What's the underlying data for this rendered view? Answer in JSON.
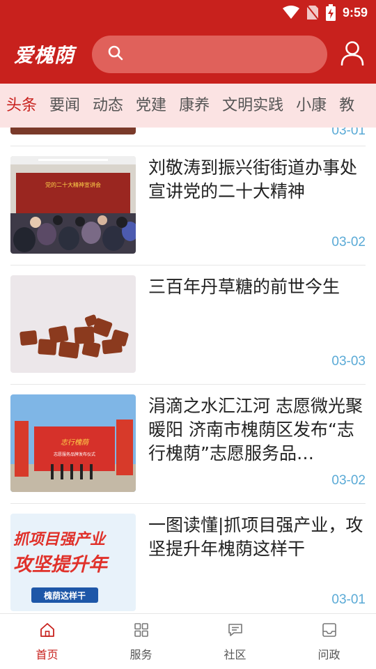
{
  "status_bar": {
    "time": "9:59"
  },
  "header": {
    "logo": "爱槐荫",
    "search_placeholder": ""
  },
  "tabs": [
    "头条",
    "要闻",
    "动态",
    "党建",
    "康养",
    "文明实践",
    "小康",
    "教"
  ],
  "active_tab": 0,
  "partial_item": {
    "date": "03-01"
  },
  "news": [
    {
      "title": "刘敬涛到振兴街街道办事处宣讲党的二十大精神",
      "date": "03-02",
      "image_caption": "党的二十大精神宣讲会"
    },
    {
      "title": "三百年丹草糖的前世今生",
      "date": "03-03"
    },
    {
      "title": "涓滴之水汇江河 志愿微光聚暖阳  济南市槐荫区发布“志行槐荫”志愿服务品…",
      "date": "03-02",
      "image_caption": "志行槐荫",
      "image_caption_small": "志愿服务品牌发布仪式"
    },
    {
      "title": "一图读懂|抓项目强产业，攻坚提升年槐荫这样干",
      "date": "03-01",
      "image_line1": "抓项目强产业",
      "image_line2": "攻坚提升年",
      "image_tag": "槐荫这样干"
    }
  ],
  "bottom_nav": [
    {
      "label": "首页",
      "icon": "home-icon"
    },
    {
      "label": "服务",
      "icon": "grid-icon"
    },
    {
      "label": "社区",
      "icon": "chat-icon"
    },
    {
      "label": "问政",
      "icon": "inbox-icon"
    }
  ],
  "colors": {
    "brand": "#c8211d",
    "tab_bg": "#fbe3e3",
    "date": "#5aaad6"
  }
}
